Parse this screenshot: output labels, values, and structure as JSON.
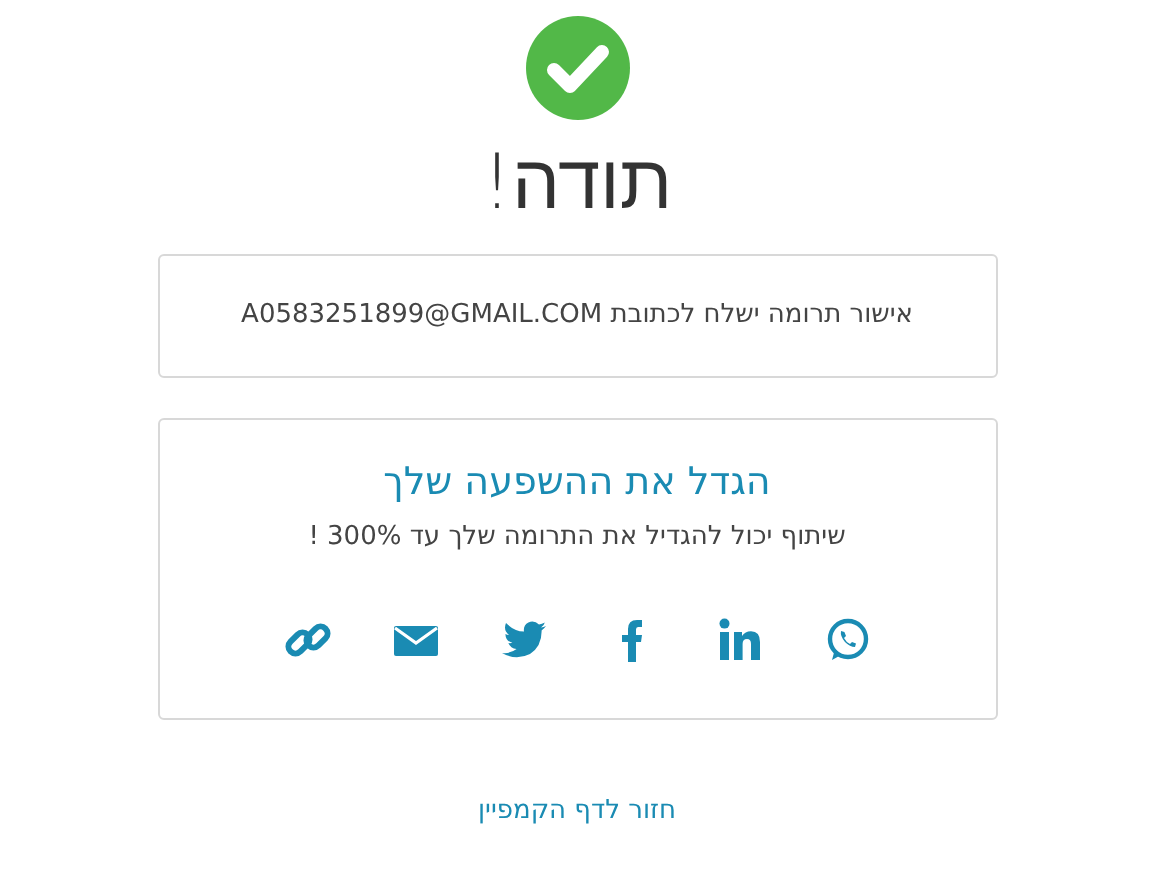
{
  "title": "תודה!",
  "confirmation": "אישור תרומה ישלח לכתובת A0583251899@GMAIL.COM",
  "share": {
    "heading": "הגדל את ההשפעה שלך",
    "subtitle": "שיתוף יכול להגדיל את התרומה שלך עד 300% !",
    "buttons": [
      {
        "kind": "whatsapp"
      },
      {
        "kind": "linkedin"
      },
      {
        "kind": "facebook"
      },
      {
        "kind": "twitter"
      },
      {
        "kind": "email"
      },
      {
        "kind": "link"
      }
    ]
  },
  "back_link": "חזור לדף הקמפיין"
}
